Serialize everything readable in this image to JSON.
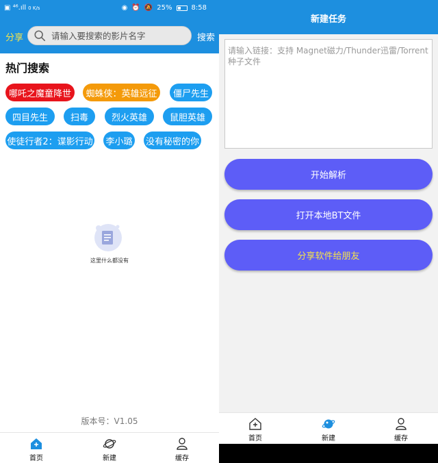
{
  "status": {
    "left_glyphs": "▣ ⁴⁶.ıll",
    "net_speed": "0 K/s",
    "icons_right": [
      "eye-icon",
      "alarm-icon",
      "mute-icon"
    ],
    "battery": "25%",
    "time": "8:58"
  },
  "left": {
    "share_label": "分享",
    "search_placeholder": "请输入要搜索的影片名字",
    "search_button": "搜索",
    "hot_title": "热门搜索",
    "tags": [
      {
        "label": "哪吒之魔童降世",
        "color": "#e8141c"
      },
      {
        "label": "蜘蛛侠：英雄远征",
        "color": "#f49a0a"
      },
      {
        "label": "僵尸先生",
        "color": "#1d9ef0"
      },
      {
        "label": "四目先生",
        "color": "#1d9ef0"
      },
      {
        "label": "扫毒",
        "color": "#1d9ef0"
      },
      {
        "label": "烈火英雄",
        "color": "#1d9ef0"
      },
      {
        "label": "鼠胆英雄",
        "color": "#1d9ef0"
      },
      {
        "label": "使徒行者2：谍影行动",
        "color": "#1d9ef0"
      },
      {
        "label": "李小璐",
        "color": "#1d9ef0"
      },
      {
        "label": "没有秘密的你",
        "color": "#1d9ef0"
      }
    ],
    "empty_text": "这里什么都没有",
    "version": "版本号：V1.05",
    "nav": [
      "首页",
      "新建",
      "缓存"
    ]
  },
  "right": {
    "title": "新建任务",
    "link_placeholder": "请输入链接：支持 Magnet磁力/Thunder迅雷/Torrent种子文件",
    "buttons": [
      {
        "label": "开始解析",
        "text_color": "#ffffff"
      },
      {
        "label": "打开本地BT文件",
        "text_color": "#ffffff"
      },
      {
        "label": "分享软件给朋友",
        "text_color": "#f6e44a"
      }
    ],
    "nav": [
      "首页",
      "新建",
      "缓存"
    ]
  },
  "colors": {
    "primary": "#1d8fdf",
    "button": "#5d5df7",
    "share": "#f6e44a"
  }
}
